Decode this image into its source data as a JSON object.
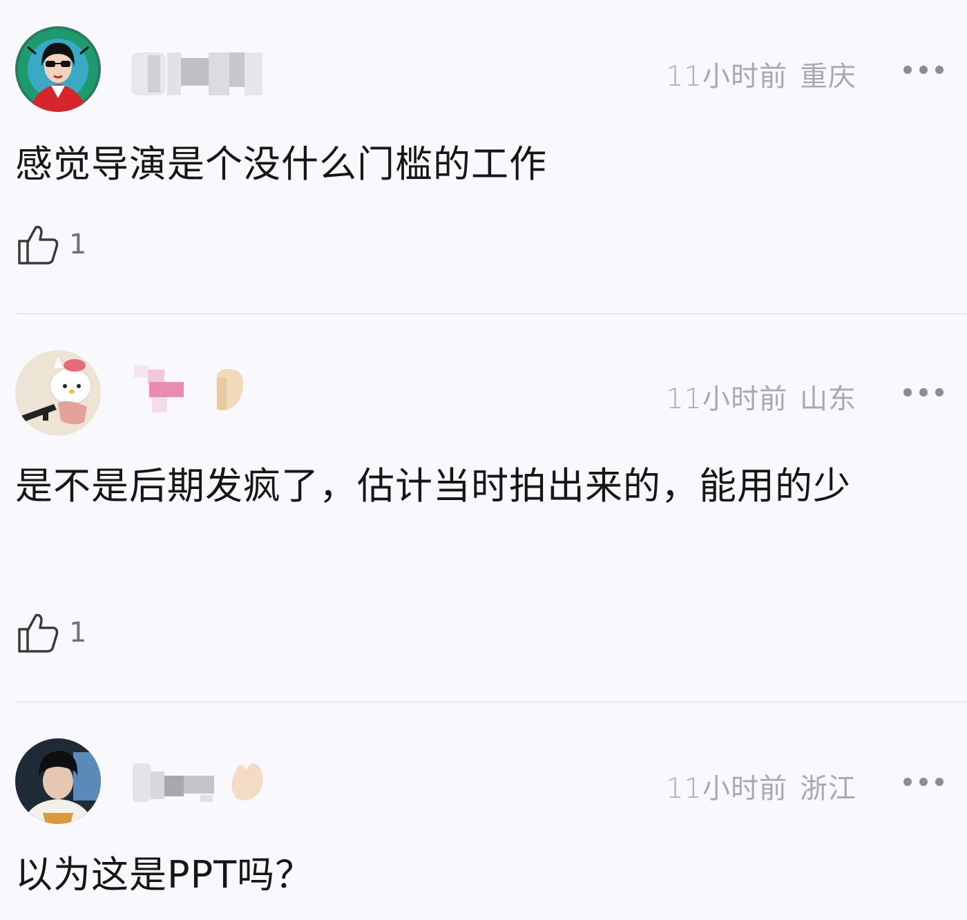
{
  "comments": [
    {
      "time": "11小时前",
      "location": "重庆",
      "text": "感觉导演是个没什么门槛的工作",
      "likes": "1",
      "avatar_icon": "avatar-woman-sunglasses-red",
      "more_icon": "more-dots-icon",
      "like_icon": "thumbs-up-icon"
    },
    {
      "time": "11小时前",
      "location": "山东",
      "text": "是不是后期发疯了，估计当时拍出来的，能用的少",
      "likes": "1",
      "avatar_icon": "avatar-hello-kitty-plush",
      "more_icon": "more-dots-icon",
      "like_icon": "thumbs-up-icon"
    },
    {
      "time": "11小时前",
      "location": "浙江",
      "text": "以为这是PPT吗？",
      "avatar_icon": "avatar-young-man-dark",
      "more_icon": "more-dots-icon"
    }
  ],
  "colors": {
    "background": "#f9f8fd",
    "meta_text": "#a8a8ad",
    "body_text": "#161616",
    "divider": "#e9e8ee"
  }
}
